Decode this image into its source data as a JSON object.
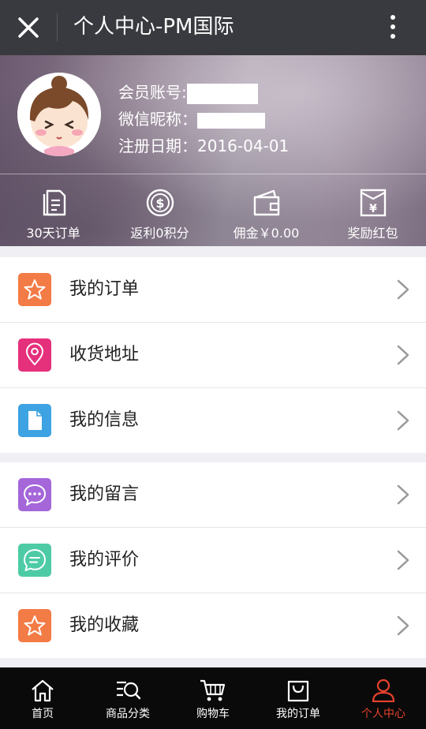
{
  "header": {
    "title": "个人中心-PM国际",
    "close_icon": "close-icon",
    "more_icon": "more-vertical-icon"
  },
  "profile": {
    "account_label": "会员账号:",
    "nickname_label": "微信昵称：",
    "register_label": "注册日期：",
    "register_date": "2016-04-01",
    "stats": [
      {
        "icon": "document-icon",
        "label": "30天订单"
      },
      {
        "icon": "dollar-coin-icon",
        "label": "返利0积分"
      },
      {
        "icon": "wallet-icon",
        "label": "佣金￥0.00"
      },
      {
        "icon": "red-envelope-icon",
        "label": "奖励红包"
      }
    ]
  },
  "menu_group1": [
    {
      "icon": "star-icon",
      "color": "#f37b45",
      "label": "我的订单"
    },
    {
      "icon": "location-pin-icon",
      "color": "#e5307c",
      "label": "收货地址"
    },
    {
      "icon": "file-icon",
      "color": "#3ea3e2",
      "label": "我的信息"
    }
  ],
  "menu_group2": [
    {
      "icon": "chat-bubble-icon",
      "color": "#a466d8",
      "label": "我的留言"
    },
    {
      "icon": "comment-icon",
      "color": "#4dcba5",
      "label": "我的评价"
    },
    {
      "icon": "star-icon",
      "color": "#f37b45",
      "label": "我的收藏"
    }
  ],
  "tabbar": {
    "tabs": [
      {
        "icon": "home-icon",
        "label": "首页"
      },
      {
        "icon": "category-search-icon",
        "label": "商品分类"
      },
      {
        "icon": "cart-icon",
        "label": "购物车"
      },
      {
        "icon": "shopping-bag-icon",
        "label": "我的订单"
      },
      {
        "icon": "user-icon",
        "label": "个人中心"
      }
    ],
    "active_color": "#e8412c"
  }
}
